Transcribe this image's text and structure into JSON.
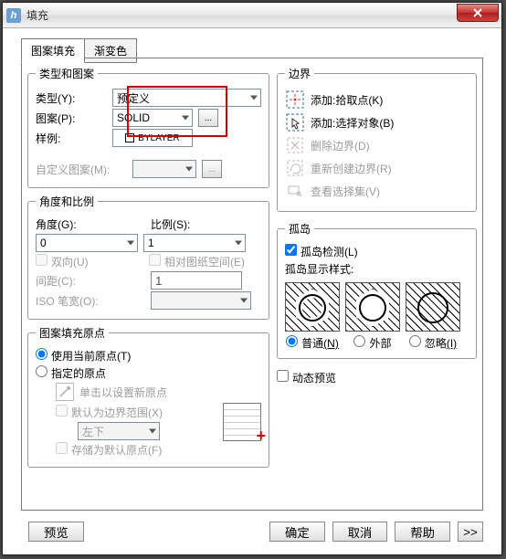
{
  "window": {
    "title": "填充"
  },
  "tabs": {
    "t1": "图案填充",
    "t2": "渐变色"
  },
  "grpTypePattern": {
    "legend": "类型和图案",
    "typeLabel": "类型(Y):",
    "typeValue": "预定义",
    "patternLabel": "图案(P):",
    "patternValue": "SOLID",
    "sampleLabel": "样例:",
    "sampleText": "BYLAYER",
    "customLabel": "自定义图案(M):"
  },
  "grpAngleScale": {
    "legend": "角度和比例",
    "angleLabel": "角度(G):",
    "angleValue": "0",
    "scaleLabel": "比例(S):",
    "scaleValue": "1",
    "doubleLabel": "双向(U)",
    "paperLabel": "相对图纸空间(E)",
    "spacingLabel": "间距(C):",
    "spacingValue": "1",
    "isoLabel": "ISO 笔宽(O):"
  },
  "grpOrigin": {
    "legend": "图案填充原点",
    "useCur": "使用当前原点(T)",
    "spec": "指定的原点",
    "clickNew": "单击以设置新原点",
    "defBound": "默认为边界范围(X)",
    "posValue": "左下",
    "storeDef": "存储为默认原点(F)"
  },
  "grpBoundary": {
    "legend": "边界",
    "addPick": "添加:拾取点(K)",
    "addSel": "添加:选择对象(B)",
    "delBound": "删除边界(D)",
    "recreate": "重新创建边界(R)",
    "viewSel": "查看选择集(V)"
  },
  "grpIsland": {
    "legend": "孤岛",
    "detect": "孤岛检测(L)",
    "styleLabel": "孤岛显示样式:",
    "opt1": "普通",
    "opt1hot": "(N)",
    "opt2": "外部",
    "opt3": "忽略",
    "opt3hot": "(I)"
  },
  "dynPreview": "动态预览",
  "footer": {
    "preview": "预览",
    "ok": "确定",
    "cancel": "取消",
    "help": "帮助",
    "more": ">>"
  }
}
